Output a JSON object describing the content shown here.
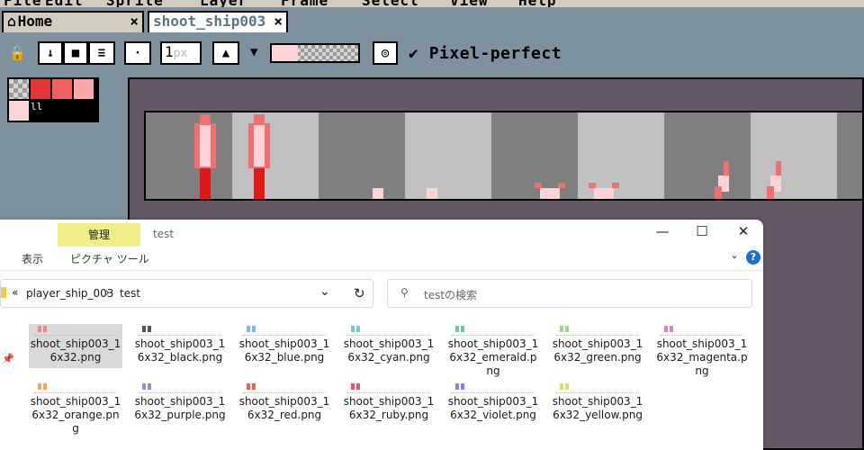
{
  "menu": [
    "File",
    "Edit",
    "Sprite",
    "Layer",
    "Frame",
    "Select",
    "View",
    "Help"
  ],
  "tabs": {
    "home": {
      "icon": "⌂",
      "label": "Home",
      "close": "×"
    },
    "active": {
      "label": "shoot_ship003",
      "close": "×"
    }
  },
  "toolbar": {
    "brush_size": "1",
    "brush_unit": "px",
    "pixel_perfect_check": "✔",
    "pixel_perfect_label": "Pixel-perfect",
    "dot_label": "·",
    "dropdown_glyph": "▼"
  },
  "palette": {
    "swatches": [
      "#9a9a9a",
      "#e53434",
      "#f06060",
      "#ffa7a7",
      "#fcd3d6"
    ],
    "fg_bg": [
      "#fcd3d6",
      "#ffffff"
    ]
  },
  "sheet": {
    "cell_colors": [
      "#7f7f7f",
      "#c0c0c0"
    ],
    "sprite_colors": {
      "core": "#fcd3d6",
      "mid": "#f07070",
      "dark": "#e01818"
    }
  },
  "explorer": {
    "ribbon": {
      "manage": "管理",
      "title": "test",
      "view": "表示",
      "picture_tools": "ピクチャ ツール"
    },
    "window_buttons": [
      "—",
      "☐",
      "✕"
    ],
    "address": {
      "prefix": "«",
      "parts": [
        "player_ship_003",
        "test"
      ],
      "sep": "›"
    },
    "search_placeholder": "testの検索",
    "files": [
      {
        "name": "shoot_ship003_16x32.png",
        "color": "#e88a8a",
        "selected": true
      },
      {
        "name": "shoot_ship003_16x32_black.png",
        "color": "#555555"
      },
      {
        "name": "shoot_ship003_16x32_blue.png",
        "color": "#8ab4e8"
      },
      {
        "name": "shoot_ship003_16x32_cyan.png",
        "color": "#79c8cf"
      },
      {
        "name": "shoot_ship003_16x32_emerald.png",
        "color": "#6fc9a0"
      },
      {
        "name": "shoot_ship003_16x32_green.png",
        "color": "#9fd98d"
      },
      {
        "name": "shoot_ship003_16x32_magenta.png",
        "color": "#d886c9"
      },
      {
        "name": "shoot_ship003_16x32_orange.png",
        "color": "#f0a860"
      },
      {
        "name": "shoot_ship003_16x32_purple.png",
        "color": "#9c8ad0"
      },
      {
        "name": "shoot_ship003_16x32_red.png",
        "color": "#e86060"
      },
      {
        "name": "shoot_ship003_16x32_ruby.png",
        "color": "#d85a7c"
      },
      {
        "name": "shoot_ship003_16x32_violet.png",
        "color": "#9a7ae0"
      },
      {
        "name": "shoot_ship003_16x32_yellow.png",
        "color": "#e0d868"
      }
    ]
  }
}
